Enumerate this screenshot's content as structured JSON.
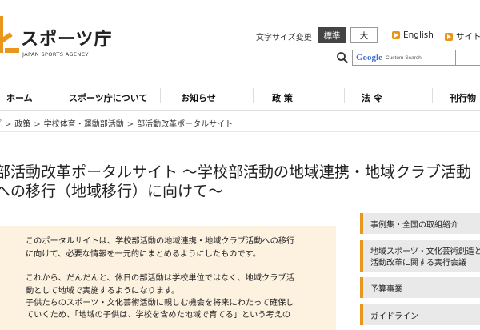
{
  "header": {
    "logo_title": "スポーツ庁",
    "logo_subtitle": "JAPAN SPORTS AGENCY",
    "font_size_label": "文字サイズ変更",
    "font_standard": "標準",
    "font_large": "大",
    "lang_english": "English",
    "lang_sitemap": "サイト",
    "search_brand": "Google",
    "search_custom": "Custom Search"
  },
  "nav": {
    "home": "ホーム",
    "about": "スポーツ庁について",
    "news": "お知らせ",
    "policy": "政 策",
    "law": "法 令",
    "publications": "刊行物"
  },
  "breadcrumb": [
    "ブ",
    "政策",
    "学校体育・運動部活動",
    "部活動改革ポータルサイト"
  ],
  "page": {
    "title_line1": "部活動改革ポータルサイト ～学校部活動の地域連携・地域クラブ活動",
    "title_line2": "への移行（地域移行）に向けて～"
  },
  "intro": {
    "p1_line1": "このポータルサイトは、学校部活動の地域連携・地域クラブ活動への移行",
    "p1_line2": "に向けて、必要な情報を一元的にまとめるようにしたものです。",
    "p2_line1": "これから、だんだんと、休日の部活動は学校単位ではなく、地域クラブ活",
    "p2_line2": "動として地域で実施するようになります。",
    "p3_line1": "子供たちのスポーツ・文化芸術活動に親しむ機会を将来にわたって確保し",
    "p3_line2": "ていくため、「地域の子供は、学校を含めた地域で育てる」という考えの"
  },
  "sidebar": {
    "item1": "事例集・全国の取組紹介",
    "item2_line1": "地域スポーツ・文化芸術創造と",
    "item2_line2": "活動改革に関する実行会議",
    "item3": "予算事業",
    "item4": "ガイドライン"
  },
  "colors": {
    "accent": "#e9961c",
    "intro_bg": "#fdf1df",
    "sidebar_bg": "#e9e9e9"
  }
}
